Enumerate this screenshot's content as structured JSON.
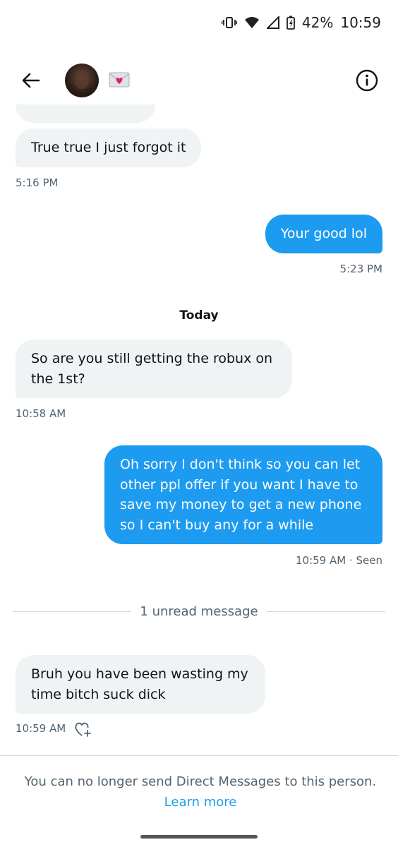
{
  "status_bar": {
    "battery": "42%",
    "time": "10:59"
  },
  "header": {
    "back_icon": "arrow-left-icon",
    "envelope_icon": "love-letter-emoji",
    "info_icon": "info-circle-icon"
  },
  "messages": [
    {
      "dir": "in",
      "text": "True true I just forgot it",
      "time": "5:16 PM"
    },
    {
      "dir": "out",
      "text": "Your good lol",
      "time": "5:23 PM"
    },
    {
      "dir": "in",
      "text": "So are you still getting the robux on the 1st?",
      "time": "10:58 AM"
    },
    {
      "dir": "out",
      "text": "Oh sorry I don't think so you can let other ppl offer if you want I have to save my money to get a new phone so I can't buy any for a while",
      "time": "10:59 AM · Seen"
    },
    {
      "dir": "in",
      "text": "Bruh you have been wasting my time bitch suck dick",
      "time": "10:59 AM"
    }
  ],
  "day_separator": "Today",
  "unread_divider": "1 unread message",
  "footer": {
    "notice": "You can no longer send Direct Messages to this person.",
    "link": "Learn more"
  },
  "colors": {
    "accent": "#1d9bf0",
    "incoming_bubble": "#eff3f4",
    "muted_text": "#536471"
  }
}
